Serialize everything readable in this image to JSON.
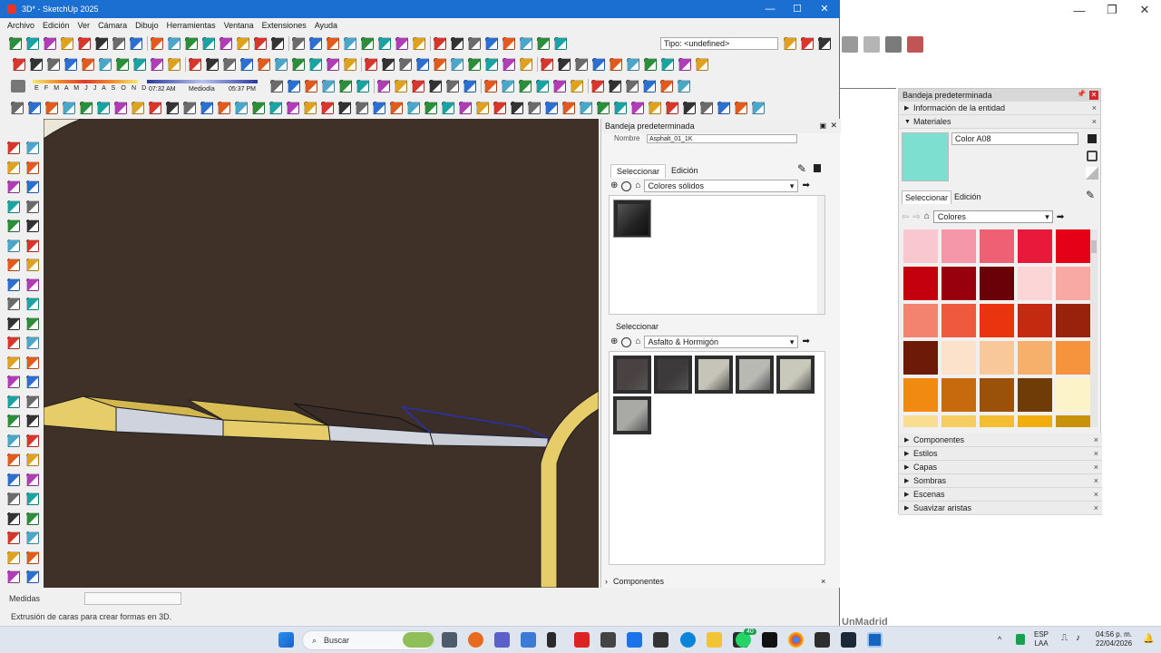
{
  "window": {
    "title": "3D* - SketchUp 2025",
    "controls": {
      "minimize": "—",
      "maximize": "☐",
      "close": "✕"
    }
  },
  "menu": [
    "Archivo",
    "Edición",
    "Ver",
    "Cámara",
    "Dibujo",
    "Herramientas",
    "Ventana",
    "Extensiones",
    "Ayuda"
  ],
  "toolbar": {
    "type_field": "Tipo: <undefined>",
    "shadow_months": "E F M A M J J A S O N D",
    "time_start": "07:32 AM",
    "time_mid": "Mediodía",
    "time_end": "05:37 PM"
  },
  "inner_tray": {
    "title": "Bandeja predeterminada",
    "name_label": "Nombre",
    "name_value": "Asphalt_01_1K",
    "tab_select": "Seleccionar",
    "tab_edit": "Edición",
    "library_top": "Colores sólidos",
    "tab_select_lower": "Seleccionar",
    "library_bottom": "Asfalto & Hormigón",
    "components_collapsed": "Componentes"
  },
  "right_tray": {
    "title": "Bandeja predeterminada",
    "sections_top": [
      "Información de la entidad",
      "Materiales"
    ],
    "material_name": "Color A08",
    "material_color": "#7ddfcf",
    "tab_select": "Seleccionar",
    "tab_edit": "Edición",
    "library": "Colores",
    "swatches": [
      "#f8c7cf",
      "#f597a8",
      "#f06075",
      "#e8193a",
      "#e60017",
      "#c4000f",
      "#98000d",
      "#6a0008",
      "#fcd6d6",
      "#f8a9a3",
      "#f3826f",
      "#ef5a3f",
      "#ea3410",
      "#c42a0f",
      "#98220c",
      "#6d1a08",
      "#fde2cb",
      "#f9c89a",
      "#f7b06b",
      "#f5943d",
      "#f08a10",
      "#c76a0d",
      "#9a520a",
      "#6f3b07",
      "#fdf3c8",
      "#f9dd93",
      "#f7cd60",
      "#f4be31",
      "#f2ae0c",
      "#c8930a"
    ],
    "sections_bottom": [
      "Componentes",
      "Estilos",
      "Capas",
      "Sombras",
      "Escenas",
      "Suavizar aristas"
    ]
  },
  "background_window": {
    "controls": {
      "minimize": "—",
      "maximize": "❐",
      "close": "✕"
    },
    "brand_fragment": "UnMadrid"
  },
  "status": {
    "measure_label": "Medidas",
    "hint": "Extrusión de caras para crear formas en 3D."
  },
  "taskbar": {
    "search": "Buscar",
    "lang": "ESP",
    "layout": "LAA",
    "time": "04:56 p. m.",
    "date": "22/04/2026",
    "badge": "40"
  }
}
